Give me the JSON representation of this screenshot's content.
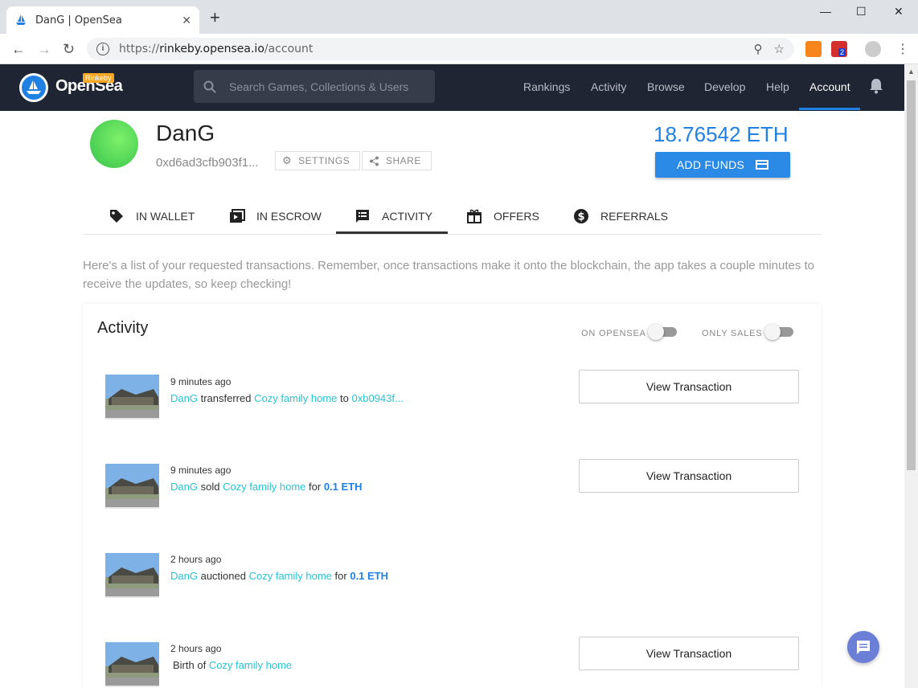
{
  "browser": {
    "tab_title": "DanG | OpenSea",
    "tab_close": "✕",
    "new_tab": "+",
    "win_min": "—",
    "win_max": "☐",
    "win_close": "✕",
    "back": "←",
    "forward": "→",
    "reload": "↻",
    "info": "i",
    "url_scheme": "https://",
    "url_host": "rinkeby.opensea.io",
    "url_path": "/account",
    "zoom_icon": "⚲",
    "star": "☆",
    "ext_badge": "2",
    "menu": "⋮"
  },
  "header": {
    "logo_text": "OpenSea",
    "badge": "Rinkeby",
    "search_placeholder": "Search Games, Collections & Users",
    "nav": [
      "Rankings",
      "Activity",
      "Browse",
      "Develop",
      "Help",
      "Account"
    ],
    "active_nav": "Account"
  },
  "profile": {
    "username": "DanG",
    "address": "0xd6ad3cfb903f1...",
    "settings_label": "SETTINGS",
    "share_label": "SHARE",
    "balance": "18.76542 ETH",
    "add_funds_label": "ADD FUNDS"
  },
  "tabs": [
    "IN WALLET",
    "IN ESCROW",
    "ACTIVITY",
    "OFFERS",
    "REFERRALS"
  ],
  "active_tab": "ACTIVITY",
  "intro": "Here's a list of your requested transactions. Remember, once transactions make it onto the blockchain, the app takes a couple minutes to receive the updates, so keep checking!",
  "activity": {
    "title": "Activity",
    "toggle_opensea": "ON OPENSEA",
    "toggle_sales": "ONLY SALES",
    "view_label": "View Transaction",
    "items": [
      {
        "time": "9 minutes ago",
        "user": "DanG",
        "verb": "transferred",
        "asset": "Cozy family home",
        "prep": "to",
        "target": "0xb0943f..."
      },
      {
        "time": "9 minutes ago",
        "user": "DanG",
        "verb": "sold",
        "asset": "Cozy family home",
        "prep": "for",
        "target": "0.1 ETH"
      },
      {
        "time": "2 hours ago",
        "user": "DanG",
        "verb": "auctioned",
        "asset": "Cozy family home",
        "prep": "for",
        "target": "0.1 ETH"
      },
      {
        "time": "2 hours ago",
        "lead": "Birth of",
        "asset": "Cozy family home"
      }
    ]
  },
  "colors": {
    "nav_bg": "#1f2532",
    "accent": "#2081e2",
    "link": "#28c4d4"
  }
}
